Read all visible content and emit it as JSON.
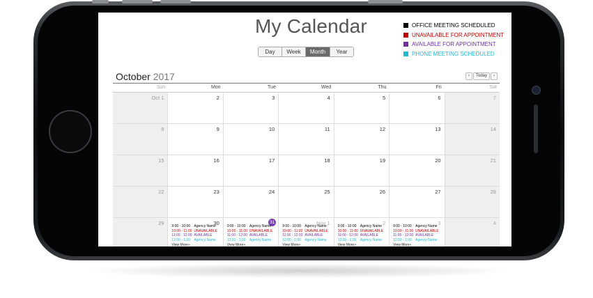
{
  "colors": {
    "office_meeting": "#000000",
    "unavailable": "#c00000",
    "available": "#7030a0",
    "phone_meeting": "#1fb7d6",
    "today_badge": "#7a3fb3"
  },
  "app": {
    "title": "My Calendar"
  },
  "view_tabs": [
    {
      "label": "Day",
      "active": false
    },
    {
      "label": "Week",
      "active": false
    },
    {
      "label": "Month",
      "active": true
    },
    {
      "label": "Year",
      "active": false
    }
  ],
  "legend": [
    {
      "label": "OFFICE MEETING SCHEDULED",
      "color": "#000000"
    },
    {
      "label": "UNAVAILABLE FOR APPOINTMENT",
      "color": "#c00000"
    },
    {
      "label": "AVAILABLE FOR APPOINTMENT",
      "color": "#7030a0"
    },
    {
      "label": "PHONE MEETING SCHEDULED",
      "color": "#1fb7d6"
    }
  ],
  "header": {
    "month": "October",
    "year": "2017"
  },
  "nav": {
    "prev": "‹",
    "today": "Today",
    "next": "›"
  },
  "weekdays": [
    "Sun",
    "Mon",
    "Tue",
    "Wed",
    "Thu",
    "Fri",
    "Sat"
  ],
  "weeks": [
    [
      "Oct 1",
      "2",
      "3",
      "4",
      "5",
      "6",
      "7"
    ],
    [
      "8",
      "9",
      "10",
      "11",
      "12",
      "13",
      "14"
    ],
    [
      "15",
      "16",
      "17",
      "18",
      "19",
      "20",
      "21"
    ],
    [
      "22",
      "23",
      "24",
      "25",
      "26",
      "27",
      "28"
    ],
    [
      "29",
      "30",
      "31",
      "Nov 1",
      "2",
      "3",
      "4"
    ]
  ],
  "today": "31",
  "day_events": [
    {
      "time": "9:00 - 10:00",
      "label": "Agency Name",
      "kind": "office_meeting"
    },
    {
      "time": "10:00 - 11:00",
      "label": "UNAVAILABLE",
      "kind": "unavailable"
    },
    {
      "time": "11:00 - 12:00",
      "label": "AVAILABLE",
      "kind": "available"
    },
    {
      "time": "12:00 -  1:00",
      "label": "Agency Name",
      "kind": "phone_meeting"
    }
  ],
  "view_more": "View More»"
}
